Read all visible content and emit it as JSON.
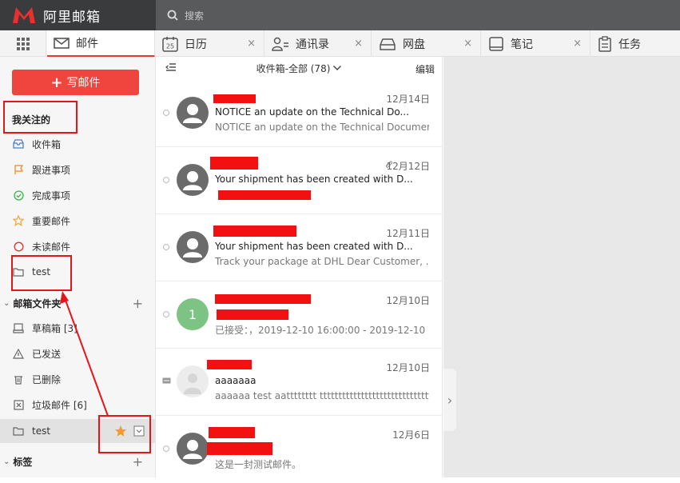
{
  "app": {
    "brand": "阿里邮箱",
    "search_placeholder": "搜索"
  },
  "tabs": [
    {
      "label": "邮件",
      "icon": "mail-icon",
      "active": true
    },
    {
      "label": "日历",
      "icon": "calendar-icon",
      "badge": "25",
      "close": "×"
    },
    {
      "label": "通讯录",
      "icon": "contacts-icon",
      "close": "×"
    },
    {
      "label": "网盘",
      "icon": "drive-icon",
      "close": "×"
    },
    {
      "label": "笔记",
      "icon": "notebook-icon",
      "close": "×"
    },
    {
      "label": "任务",
      "icon": "clipboard-icon"
    }
  ],
  "sidebar": {
    "compose_label": "写邮件",
    "favorites_title": "我关注的",
    "favorites": [
      {
        "label": "收件箱",
        "icon": "inbox-icon"
      },
      {
        "label": "跟进事项",
        "icon": "flag-icon"
      },
      {
        "label": "完成事项",
        "icon": "check-circle-icon"
      },
      {
        "label": "重要邮件",
        "icon": "star-icon"
      },
      {
        "label": "未读邮件",
        "icon": "circle-icon"
      },
      {
        "label": "test",
        "icon": "folder-icon"
      }
    ],
    "folders_title": "邮箱文件夹",
    "folders": [
      {
        "label": "草稿箱 [3]",
        "icon": "drafts-icon"
      },
      {
        "label": "已发送",
        "icon": "sent-icon"
      },
      {
        "label": "已删除",
        "icon": "trash-icon"
      },
      {
        "label": "垃圾邮件 [6]",
        "icon": "spam-icon"
      },
      {
        "label": "test",
        "icon": "folder-icon"
      }
    ],
    "tags_title": "标签"
  },
  "list": {
    "title": "收件箱-全部 (78)",
    "edit_label": "编辑",
    "mails": [
      {
        "sender": "",
        "date": "12月14日",
        "subject": "NOTICE an update on the Technical Do...",
        "preview": "NOTICE an update on the Technical Document...",
        "avatar": "user"
      },
      {
        "sender": "",
        "date": "12月12日",
        "subject": "Your shipment has been created with D...",
        "preview": "",
        "avatar": "user",
        "attachment": true
      },
      {
        "sender": "",
        "date": "12月11日",
        "subject": "Your shipment has been created with D...",
        "preview": "Track your package at DHL   Dear Customer,  ...",
        "avatar": "user"
      },
      {
        "sender": "",
        "date": "12月10日",
        "subject": "",
        "preview": "已接受：，2019-12-10 16:00:00 - 2019-12-10 ...",
        "avatar": "letter",
        "letter": "1"
      },
      {
        "sender": "",
        "date": "12月10日",
        "subject": "aaaaaaa",
        "preview": "aaaaaa test aatttttttt tttttttttttttttttttttttttttttttttttttttttt...",
        "avatar": "photo"
      },
      {
        "sender": "",
        "date": "12月6日",
        "subject": "",
        "preview": "这是一封测试邮件。",
        "avatar": "user"
      }
    ]
  },
  "colors": {
    "accent": "#f0453f",
    "annotation": "#e8141c",
    "avatar_green": "#7dc383"
  }
}
